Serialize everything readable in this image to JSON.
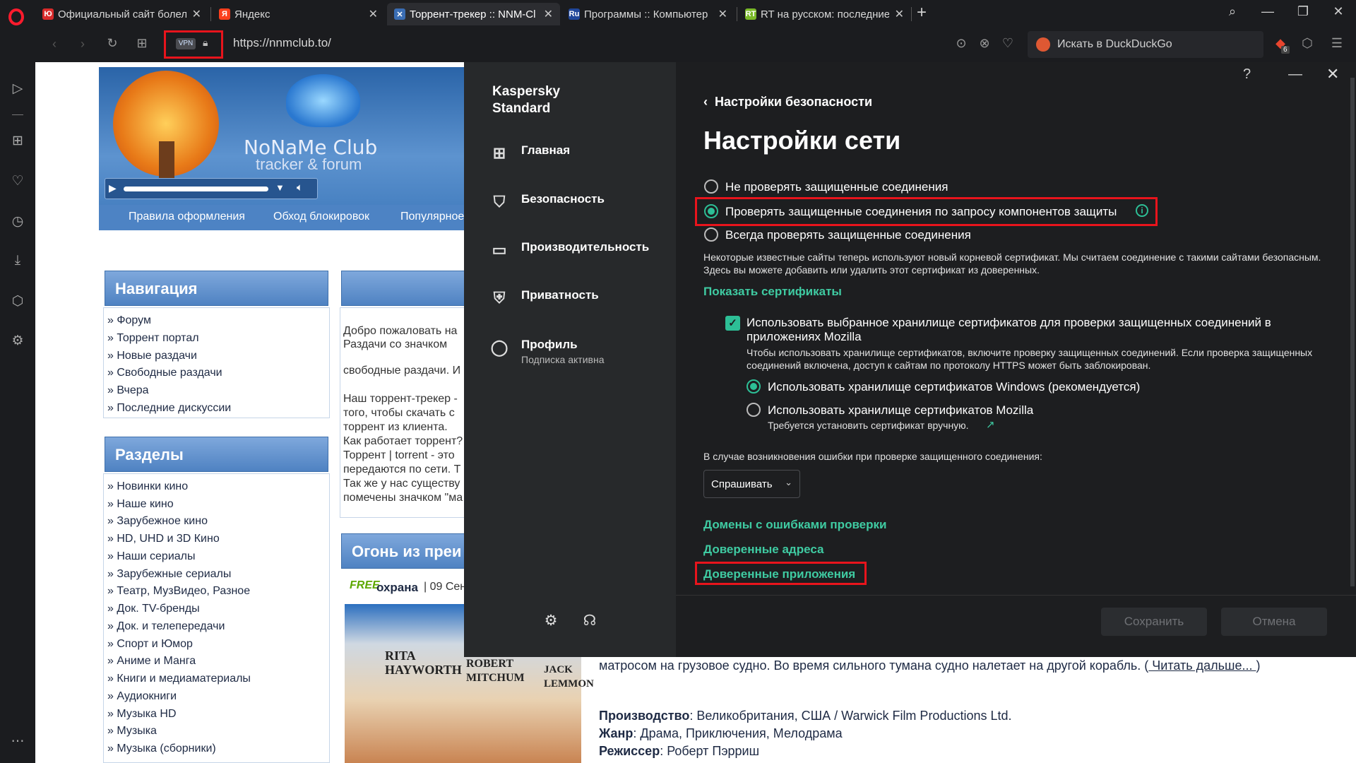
{
  "browser": {
    "tabs": [
      {
        "label": "Официальный сайт болел",
        "fav_color": "#d92b2b",
        "fav_text": "Ю"
      },
      {
        "label": "Яндекс",
        "fav_color": "#fc3f1d",
        "fav_text": "Я"
      },
      {
        "label": "Торрент-трекер :: NNM-Cl",
        "fav_color": "#3a6db3",
        "fav_text": "✕",
        "active": true
      },
      {
        "label": "Программы :: Компьютер",
        "fav_color": "#20479b",
        "fav_text": "Ru"
      },
      {
        "label": "RT на русском: последние",
        "fav_color": "#7ab929",
        "fav_text": "RT"
      }
    ],
    "vpn_badge": "VPN",
    "url": "https://nnmclub.to/",
    "search_placeholder": "Искать в DuckDuckGo",
    "extension_badge": "6"
  },
  "site": {
    "brand_title": "NoNaMe Club",
    "brand_subtitle": "tracker & forum",
    "banner_links": [
      "Правила оформления",
      "Обход блокировок",
      "Популярное"
    ],
    "nav_panel": {
      "title": "Навигация",
      "items": [
        "» Форум",
        "» Торрент портал",
        "» Новые раздачи",
        "» Свободные раздачи",
        "» Вчера",
        "» Последние дискуссии"
      ]
    },
    "sections_panel": {
      "title": "Разделы",
      "items": [
        "» Новинки кино",
        "» Наше кино",
        "» Зарубежное кино",
        "» HD, UHD и 3D Кино",
        "» Наши сериалы",
        "» Зарубежные сериалы",
        "» Театр, МузВидео, Разное",
        "» Док. TV-бренды",
        "» Док. и телепередачи",
        "» Спорт и Юмор",
        "» Аниме и Манга",
        "» Книги и медиаматериалы",
        "» Аудиокниги",
        "» Музыка HD",
        "» Музыка",
        "» Музыка (сборники)"
      ]
    },
    "welcome_lines": [
      "Добро пожаловать на",
      "Раздачи со значком",
      "свободные раздачи. И",
      "Наш торрент-трекер -",
      "того, чтобы скачать с",
      "торрент из клиента.",
      "Как работает торрент?",
      "Торрент | torrent - это",
      "передаются по сети. Т",
      "Так же у нас существу",
      "помечены значком \"ма"
    ],
    "fire_title": "Огонь из преи",
    "free_badge": "FREE",
    "free_line_title": "охрана",
    "free_line_rest": "| 09 Сен",
    "movie_synopsis_1": "матросом на грузовое судно. Во время сильного тумана судно налетает на другой корабль. (",
    "read_more": " Читать дальше... ",
    "movie_synopsis_close": ")",
    "production_label": "Производство",
    "production_value": ": Великобритания, США / Warwick Film Productions Ltd.",
    "genre_label": "Жанр",
    "genre_value": ": Драма, Приключения, Мелодрама",
    "director_label": "Режиссер",
    "director_value": ": Роберт Пэрриш",
    "dvd_names": [
      "RITA HAYWORTH",
      "ROBERT MITCHUM",
      "JACK LEMMON"
    ]
  },
  "kaspersky": {
    "brand": "Kaspersky Standard",
    "nav": [
      {
        "label": "Главная",
        "icon": "home-grid-icon"
      },
      {
        "label": "Безопасность",
        "icon": "shield-icon"
      },
      {
        "label": "Производительность",
        "icon": "monitor-icon"
      },
      {
        "label": "Приватность",
        "icon": "privacy-shield-icon"
      },
      {
        "label": "Профиль",
        "sub": "Подписка активна",
        "icon": "user-icon"
      }
    ],
    "help": "?",
    "minimize": "—",
    "close": "✕",
    "back_label": "Настройки безопасности",
    "page_title": "Настройки сети",
    "options": [
      "Не проверять защищенные соединения",
      "Проверять защищенные соединения по запросу компонентов защиты",
      "Всегда проверять защищенные соединения"
    ],
    "selected_option": 1,
    "cert_note": "Некоторые известные сайты теперь используют новый корневой сертификат. Мы считаем соединение с такими сайтами безопасным. Здесь вы можете добавить или удалить этот сертификат из доверенных.",
    "show_certs": "Показать сертификаты",
    "mozilla_check": "Использовать выбранное хранилище сертификатов для проверки защищенных соединений в приложениях Mozilla",
    "mozilla_note": "Чтобы использовать хранилище сертификатов, включите проверку защищенных соединений. Если проверка защищенных соединений включена, доступ к сайтам по протоколу HTTPS может быть заблокирован.",
    "store_windows": "Использовать хранилище сертификатов Windows (рекомендуется)",
    "store_mozilla": "Использовать хранилище сертификатов Mozilla",
    "store_mozilla_note": "Требуется установить сертификат вручную.",
    "error_label": "В случае возникновения ошибки при проверке защищенного соединения:",
    "error_select": "Спрашивать",
    "links": [
      "Домены с ошибками проверки",
      "Доверенные адреса",
      "Доверенные приложения"
    ],
    "save": "Сохранить",
    "cancel": "Отмена"
  }
}
